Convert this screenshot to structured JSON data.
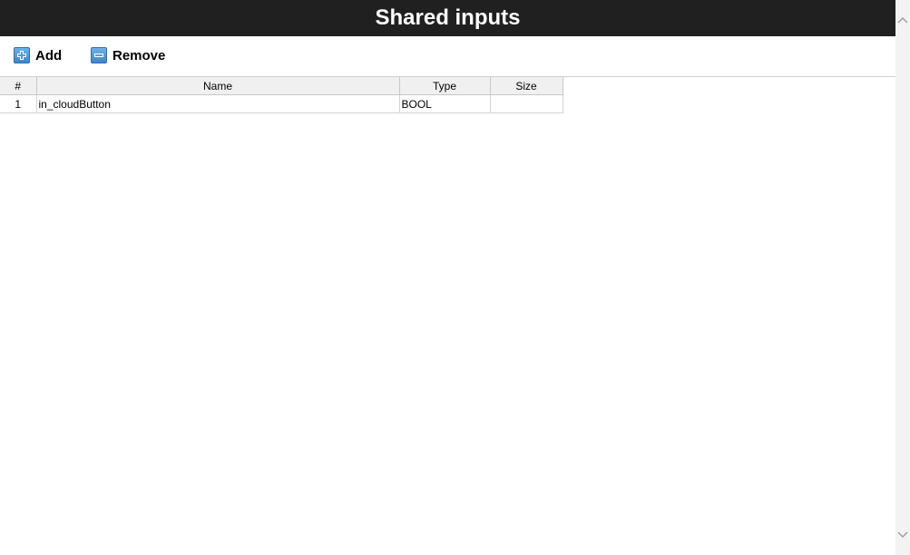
{
  "header": {
    "title": "Shared inputs"
  },
  "toolbar": {
    "add_label": "Add",
    "remove_label": "Remove"
  },
  "table": {
    "columns": [
      "#",
      "Name",
      "Type",
      "Size"
    ],
    "rows": [
      {
        "index": "1",
        "name": "in_cloudButton",
        "type": "BOOL",
        "size": ""
      }
    ]
  },
  "colors": {
    "title_bar": "#202020",
    "title_text": "#ffffff",
    "icon_blue": "#3e86c8",
    "header_bg": "#f0f0f0"
  },
  "icons": {
    "add": "plus-square-icon",
    "remove": "minus-square-icon",
    "scroll_up": "chevron-up-icon",
    "scroll_down": "chevron-down-icon"
  }
}
